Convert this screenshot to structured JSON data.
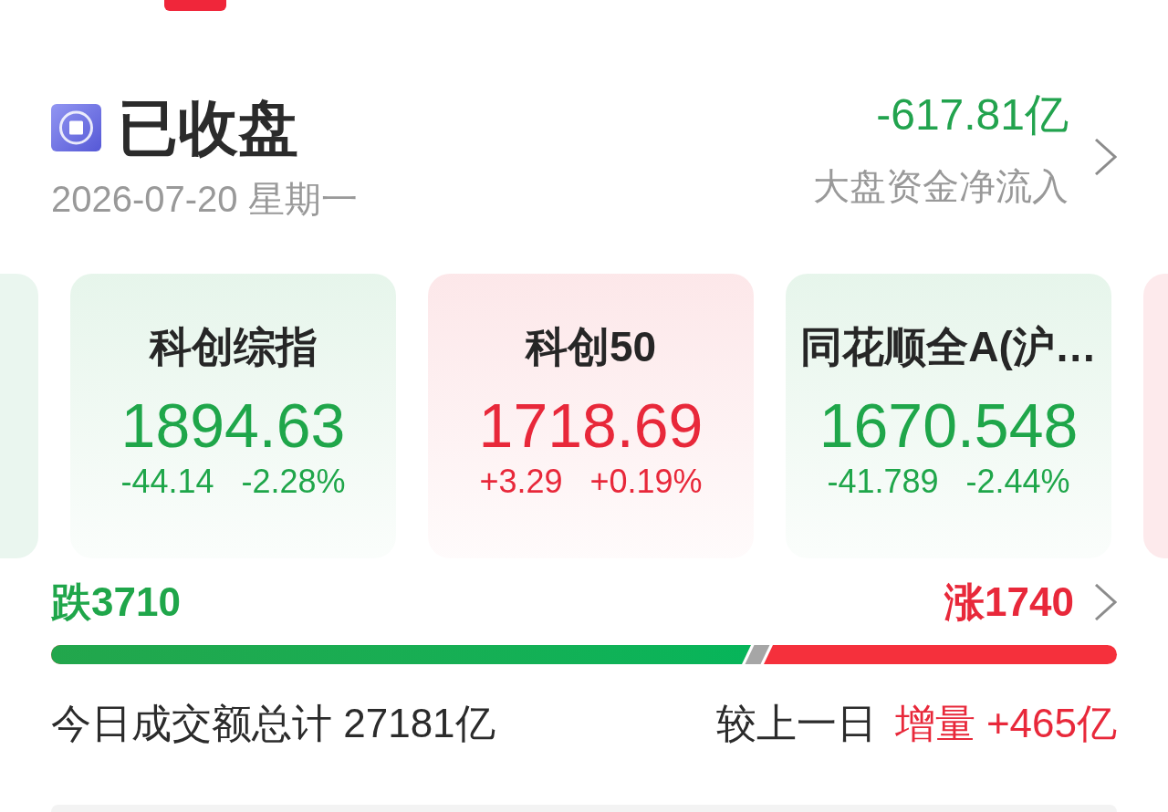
{
  "status": {
    "label": "已收盘",
    "date": "2026-07-20 星期一"
  },
  "net_inflow": {
    "value": "-617.81亿",
    "label": "大盘资金净流入"
  },
  "index_cards": [
    {
      "kind": "clipped",
      "color": "#eaf6ef"
    },
    {
      "kind": "full",
      "color": "#1fa64a",
      "title": "科创综指",
      "value": "1894.63",
      "change": "-44.14",
      "change_percent": "-2.28%"
    },
    {
      "kind": "full",
      "color": "#e8283a",
      "title": "科创50",
      "value": "1718.69",
      "change": "+3.29",
      "change_percent": "+0.19%"
    },
    {
      "kind": "full",
      "color": "#1fa64a",
      "title": "同花顺全A(沪…",
      "value": "1670.548",
      "change": "-41.789",
      "change_percent": "-2.44%"
    },
    {
      "kind": "clipped",
      "color": "#fdeaec"
    }
  ],
  "breadth": {
    "falls": "跌3710",
    "rises": "涨1740",
    "level": 0.657
  },
  "turnover": {
    "total": "今日成交额总计 27181亿",
    "comparison_label": "较上一日",
    "comparison_value": "增量 +465亿"
  }
}
